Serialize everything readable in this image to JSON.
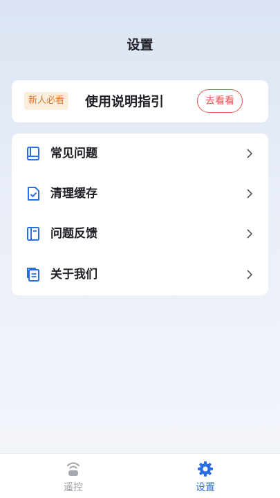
{
  "header": {
    "title": "设置"
  },
  "guide": {
    "badge": "新人必看",
    "text": "使用说明指引",
    "button": "去看看"
  },
  "menu": {
    "items": [
      {
        "label": "常见问题",
        "icon": "book-icon"
      },
      {
        "label": "清理缓存",
        "icon": "file-check-icon"
      },
      {
        "label": "问题反馈",
        "icon": "notebook-icon"
      },
      {
        "label": "关于我们",
        "icon": "documents-icon"
      }
    ]
  },
  "tabbar": {
    "tabs": [
      {
        "label": "遥控",
        "icon": "remote-icon",
        "active": false
      },
      {
        "label": "设置",
        "icon": "gear-icon",
        "active": true
      }
    ]
  },
  "colors": {
    "accent": "#2b6de6",
    "badge_text": "#e07a2f",
    "badge_bg": "#fbeedd",
    "button_red": "#e8534f",
    "inactive": "#9a9ca4"
  }
}
